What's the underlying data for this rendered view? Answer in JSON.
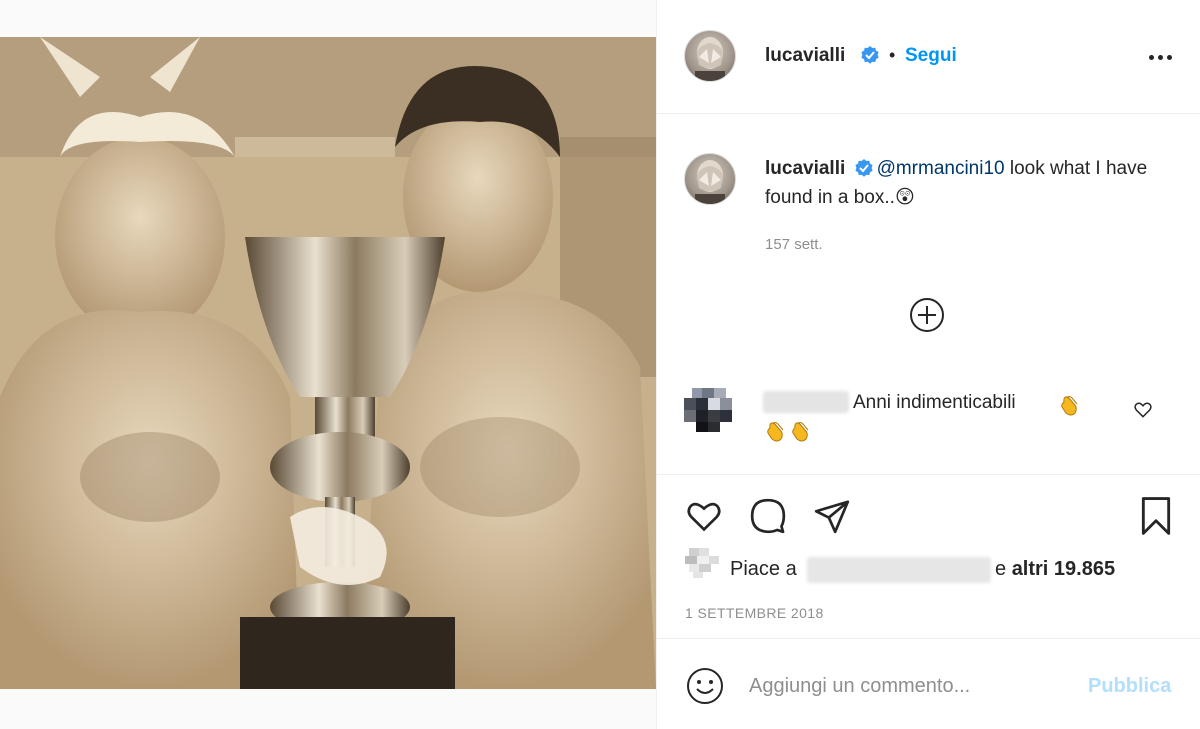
{
  "post": {
    "username": "lucavialli",
    "verified": true,
    "follow_label": "Segui",
    "separator": "•",
    "more_icon": "more-horizontal-icon"
  },
  "caption": {
    "username": "lucavialli",
    "mention": "@mrmancini10",
    "text": " look what I have found in a box..",
    "emoji": "😲",
    "time": "157 sett."
  },
  "load_more_icon": "plus-circle-icon",
  "comments": [
    {
      "text": "Anni indimenticabili",
      "emoji": "clap-emoji",
      "liked": false
    }
  ],
  "actions": {
    "icons": [
      "heart-icon",
      "comment-icon",
      "share-icon",
      "bookmark-icon"
    ]
  },
  "likes": {
    "prefix": "Piace a",
    "middle": "e",
    "count_text": "altri 19.865"
  },
  "date": "1 SETTEMBRE 2018",
  "add_comment": {
    "placeholder": "Aggiungi un commento...",
    "publish_label": "Pubblica",
    "emoji_icon": "smiley-icon"
  },
  "colors": {
    "link_blue": "#0095f6",
    "mention_blue": "#00376b",
    "publish_disabled": "#b2dffc",
    "muted": "#8e8e8e",
    "text": "#262626"
  }
}
